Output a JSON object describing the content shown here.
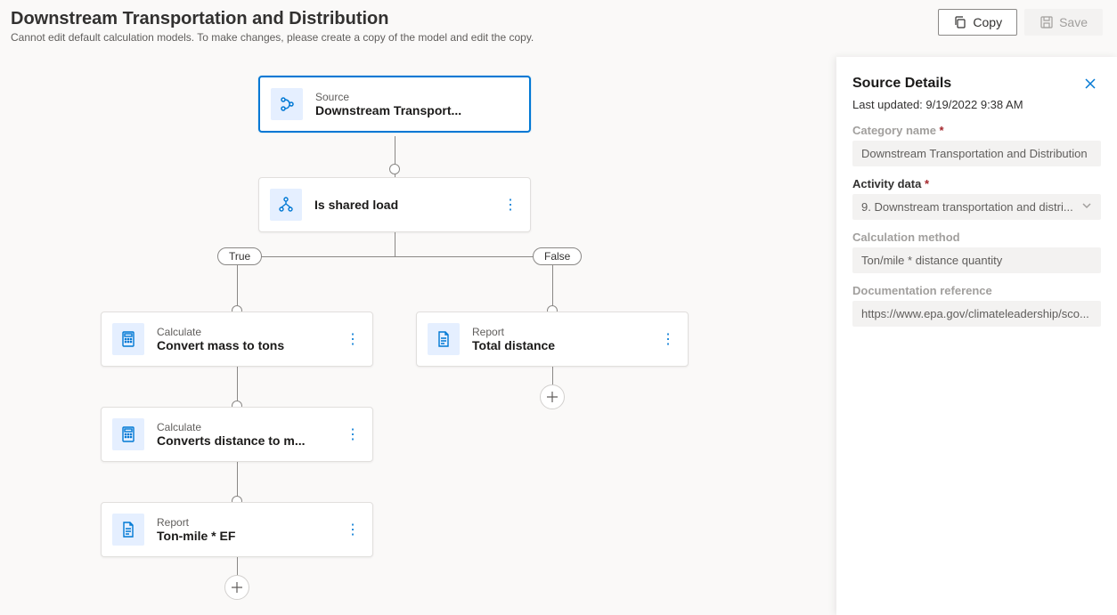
{
  "header": {
    "title": "Downstream Transportation and Distribution",
    "subtitle": "Cannot edit default calculation models. To make changes, please create a copy of the model and edit the copy.",
    "copy_label": "Copy",
    "save_label": "Save"
  },
  "flow": {
    "source": {
      "type": "Source",
      "title": "Downstream Transport..."
    },
    "condition": {
      "type": "",
      "title": "Is shared load"
    },
    "branch_true": "True",
    "branch_false": "False",
    "left1": {
      "type": "Calculate",
      "title": "Convert mass to tons"
    },
    "left2": {
      "type": "Calculate",
      "title": "Converts distance to m..."
    },
    "left3": {
      "type": "Report",
      "title": "Ton-mile * EF"
    },
    "right1": {
      "type": "Report",
      "title": "Total distance"
    }
  },
  "details": {
    "panel_title": "Source Details",
    "last_updated": "Last updated: 9/19/2022 9:38 AM",
    "category_label": "Category name",
    "category_value": "Downstream Transportation and Distribution",
    "activity_label": "Activity data",
    "activity_value": "9. Downstream transportation and distri...",
    "method_label": "Calculation method",
    "method_value": "Ton/mile * distance quantity",
    "doc_label": "Documentation reference",
    "doc_value": "https://www.epa.gov/climateleadership/sco..."
  }
}
